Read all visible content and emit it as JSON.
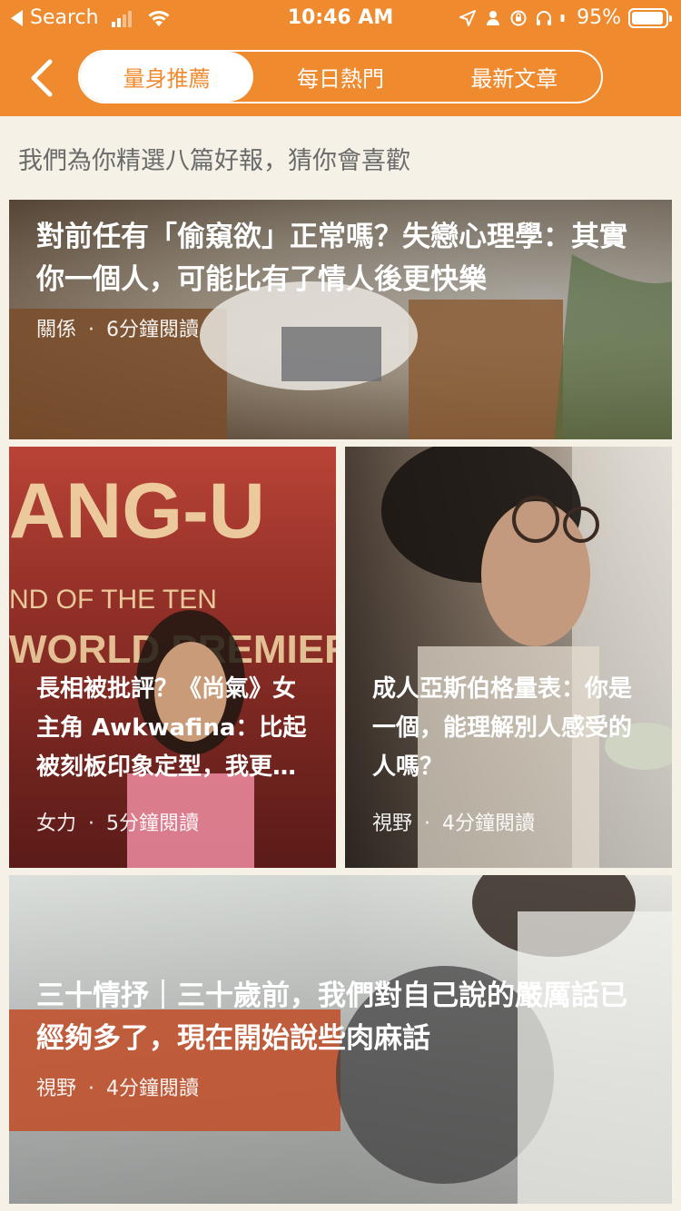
{
  "status_bar": {
    "back_app": "Search",
    "time": "10:46 AM",
    "battery": "95%",
    "battery_level": 0.95
  },
  "nav": {
    "tabs": [
      {
        "label": "量身推薦",
        "active": true
      },
      {
        "label": "每日熱門",
        "active": false
      },
      {
        "label": "最新文章",
        "active": false
      }
    ]
  },
  "subtitle": "我們為你精選八篇好報，猜你會喜歡",
  "articles": [
    {
      "title": "對前任有「偷窺欲」正常嗎？失戀心理學：其實你一個人，可能比有了情人後更快樂",
      "category": "關係",
      "read_time": "6分鐘閱讀",
      "separator": "·"
    },
    {
      "title": "長相被批評？《尚氣》女主角 Awkwafina：比起被刻板印象定型，我更想活出自己",
      "category": "女力",
      "read_time": "5分鐘閱讀",
      "separator": "·"
    },
    {
      "title": "成人亞斯伯格量表：你是一個，能理解別人感受的人嗎？",
      "category": "視野",
      "read_time": "4分鐘閱讀",
      "separator": "·"
    },
    {
      "title": "三十情抒｜三十歲前，我們對自己說的嚴厲話已經夠多了，現在開始說些肉麻話",
      "category": "視野",
      "read_time": "4分鐘閱讀",
      "separator": "·"
    }
  ],
  "colors": {
    "header": "#f08a2e",
    "background": "#f6f1e6",
    "subtitle_text": "#6b6b6b"
  }
}
